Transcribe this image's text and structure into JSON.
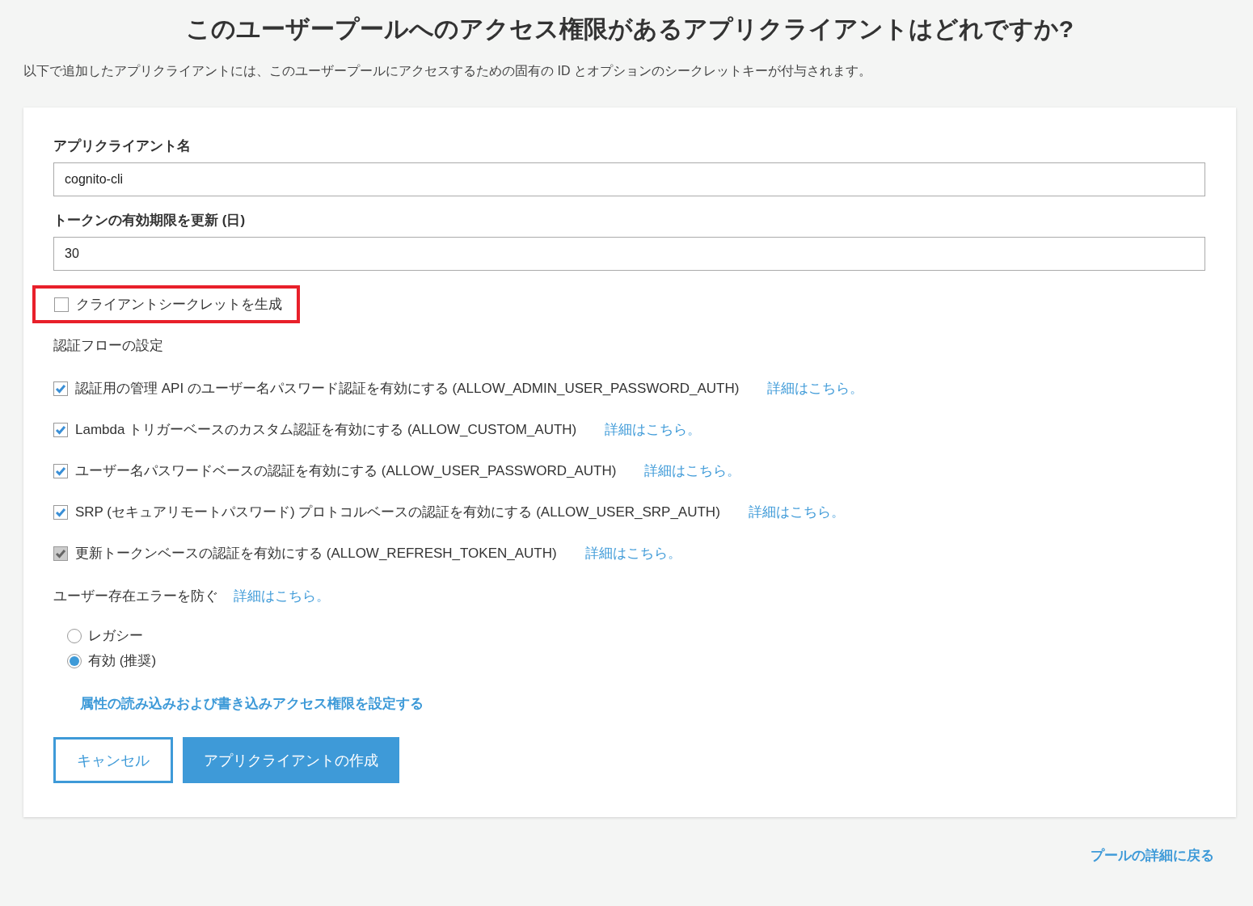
{
  "title": "このユーザープールへのアクセス権限があるアプリクライアントはどれですか?",
  "description": "以下で追加したアプリクライアントには、このユーザープールにアクセスするための固有の ID とオプションのシークレットキーが付与されます。",
  "fields": [
    {
      "label": "アプリクライアント名",
      "value": "cognito-cli"
    },
    {
      "label": "トークンの有効期限を更新 (日)",
      "value": "30"
    }
  ],
  "secret_option": {
    "label": "クライアントシークレットを生成",
    "checked": false,
    "highlighted": true
  },
  "auth_flows": {
    "heading": "認証フローの設定",
    "items": [
      {
        "label": "認証用の管理 API のユーザー名パスワード認証を有効にする (ALLOW_ADMIN_USER_PASSWORD_AUTH)",
        "checked": true,
        "disabled": false,
        "link": "詳細はこちら。"
      },
      {
        "label": "Lambda トリガーベースのカスタム認証を有効にする (ALLOW_CUSTOM_AUTH)",
        "checked": true,
        "disabled": false,
        "link": "詳細はこちら。"
      },
      {
        "label": "ユーザー名パスワードベースの認証を有効にする (ALLOW_USER_PASSWORD_AUTH)",
        "checked": true,
        "disabled": false,
        "link": "詳細はこちら。"
      },
      {
        "label": "SRP (セキュアリモートパスワード) プロトコルベースの認証を有効にする (ALLOW_USER_SRP_AUTH)",
        "checked": true,
        "disabled": false,
        "link": "詳細はこちら。"
      },
      {
        "label": "更新トークンベースの認証を有効にする (ALLOW_REFRESH_TOKEN_AUTH)",
        "checked": true,
        "disabled": true,
        "link": "詳細はこちら。"
      }
    ]
  },
  "user_existence": {
    "label": "ユーザー存在エラーを防ぐ",
    "link": "詳細はこちら。",
    "options": [
      {
        "label": "レガシー",
        "selected": false
      },
      {
        "label": "有効 (推奨)",
        "selected": true
      }
    ]
  },
  "attributes_link": "属性の読み込みおよび書き込みアクセス権限を設定する",
  "buttons": [
    {
      "label": "キャンセル",
      "kind": "secondary"
    },
    {
      "label": "アプリクライアントの作成",
      "kind": "primary"
    }
  ],
  "back_link": "プールの詳細に戻る"
}
